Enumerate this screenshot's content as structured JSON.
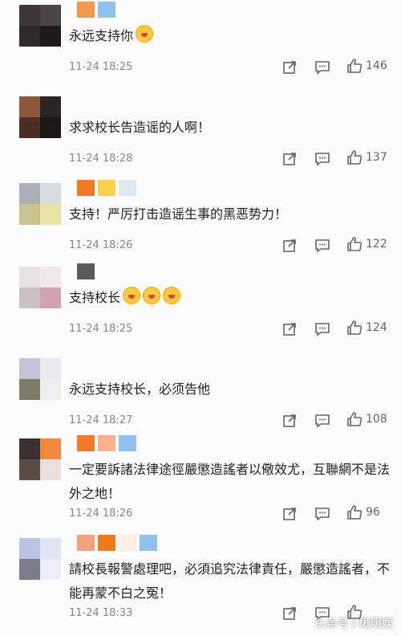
{
  "comments": [
    {
      "text": "永远支持你",
      "time": "11-24 18:25",
      "likes": "146",
      "emoji_count": 1,
      "avatar": [
        "#3b3836",
        "#4a4543",
        "#2e2a28",
        "#1c1b1a"
      ],
      "namebar": [
        "#f39a4a",
        "#8fc3ee"
      ]
    },
    {
      "text": "求求校长告造谣的人啊！",
      "time": "11-24 18:28",
      "likes": "137",
      "emoji_count": 0,
      "avatar": [
        "#8b5a3c",
        "#2b2623",
        "#4a2f22",
        "#1a1716"
      ],
      "namebar": []
    },
    {
      "text": "支持！严厉打击造谣生事的黑恶势力！",
      "time": "11-24 18:26",
      "likes": "122",
      "emoji_count": 0,
      "avatar": [
        "#a9b1b6",
        "#d9dcde",
        "#c8c490",
        "#e9e3a8"
      ],
      "namebar": [
        "#f27a22",
        "#ffcf4a",
        "#dde8f0"
      ]
    },
    {
      "text": "支持校长",
      "time": "11-24 18:25",
      "likes": "124",
      "emoji_count": 3,
      "avatar": [
        "#e6e2e2",
        "#eeeaec",
        "#c9c0c1",
        "#d3a3b2"
      ],
      "namebar": [
        "#5a5a5a"
      ]
    },
    {
      "text": "永远支持校长，必须告他",
      "time": "11-24 18:27",
      "likes": "108",
      "emoji_count": 0,
      "avatar": [
        "#c6c3d6",
        "#e8e8ee",
        "#7e7a66",
        "#eeeeee"
      ],
      "namebar": []
    },
    {
      "text": "一定要訴諸法律途徑嚴懲造謠者以儆效尤，互聯網不是法外之地！",
      "time": "11-24 18:26",
      "likes": "96",
      "emoji_count": 0,
      "avatar": [
        "#3a3030",
        "#f08a3a",
        "#5a4c46",
        "#e9e1dc"
      ],
      "namebar": [
        "#f47a2a",
        "#fbb08a",
        "#8fc3ee"
      ]
    },
    {
      "text": "請校長報警處理吧，必須追究法律責任，嚴懲造謠者，不能再蒙不白之冤！",
      "time": "11-24 18:33",
      "likes": "",
      "emoji_count": 0,
      "avatar": [
        "#b9c4e6",
        "#dfe3f2",
        "#7a7a8a",
        "#eceff7"
      ],
      "namebar": [
        "#f3a27a",
        "#f2781c",
        "#fbeee0",
        "#8fc3ee"
      ]
    }
  ],
  "watermark": "头条号 / 瞅明娱"
}
